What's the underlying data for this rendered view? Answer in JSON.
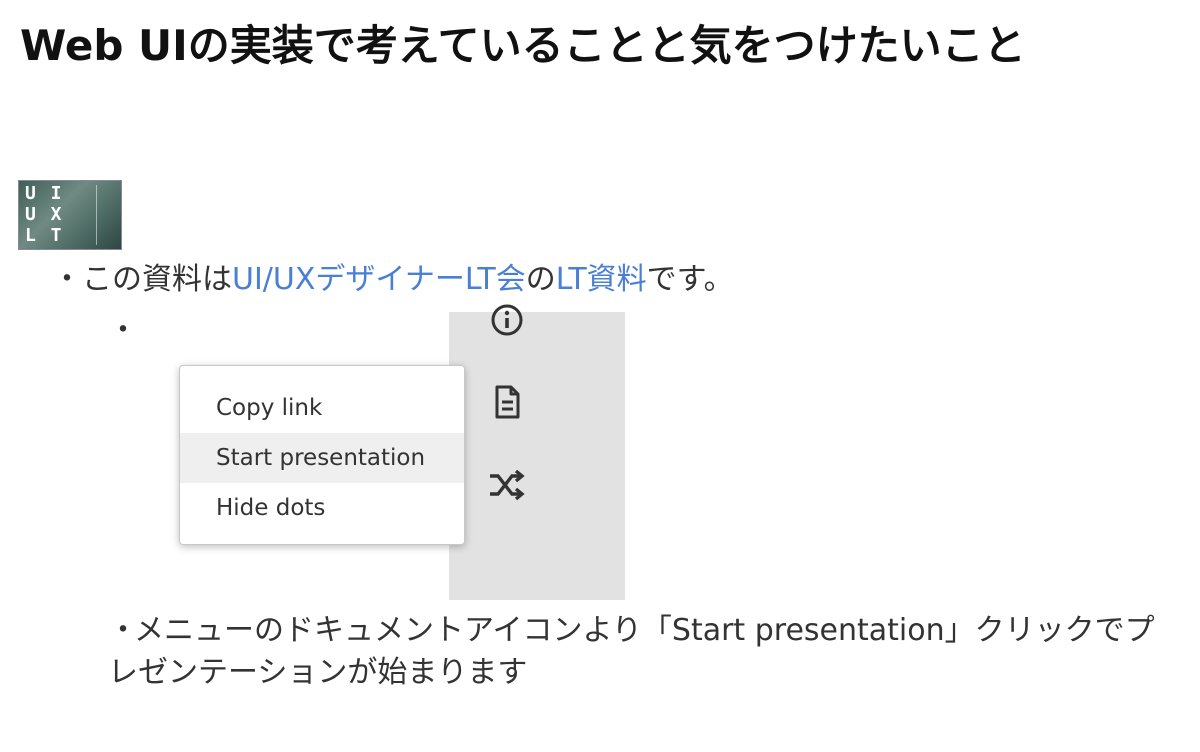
{
  "title": "Web UIの実装で考えていることと気をつけたいこと",
  "thumbnail": {
    "letters": "U I\nU X\nL T",
    "icon": "uiuxlt-thumbnail"
  },
  "bullets": {
    "bullet_mark": "・",
    "line1": {
      "prefix": "この資料は",
      "link1": "UI/UXデザイナーLT会",
      "middle": "の",
      "link2": "LT資料",
      "suffix": "です。"
    },
    "line3": "メニューのドキュメントアイコンより「Start presentation」クリックでプレゼンテーションが始まります"
  },
  "menu": {
    "items": [
      {
        "label": "Copy link",
        "active": false
      },
      {
        "label": "Start presentation",
        "active": true
      },
      {
        "label": "Hide dots",
        "active": false
      }
    ]
  },
  "rail": {
    "icons": [
      "info-icon",
      "document-icon",
      "shuffle-icon"
    ]
  },
  "colors": {
    "link": "#4a7fd6",
    "rail_bg": "#e2e2e2",
    "menu_active_bg": "#efefef"
  }
}
